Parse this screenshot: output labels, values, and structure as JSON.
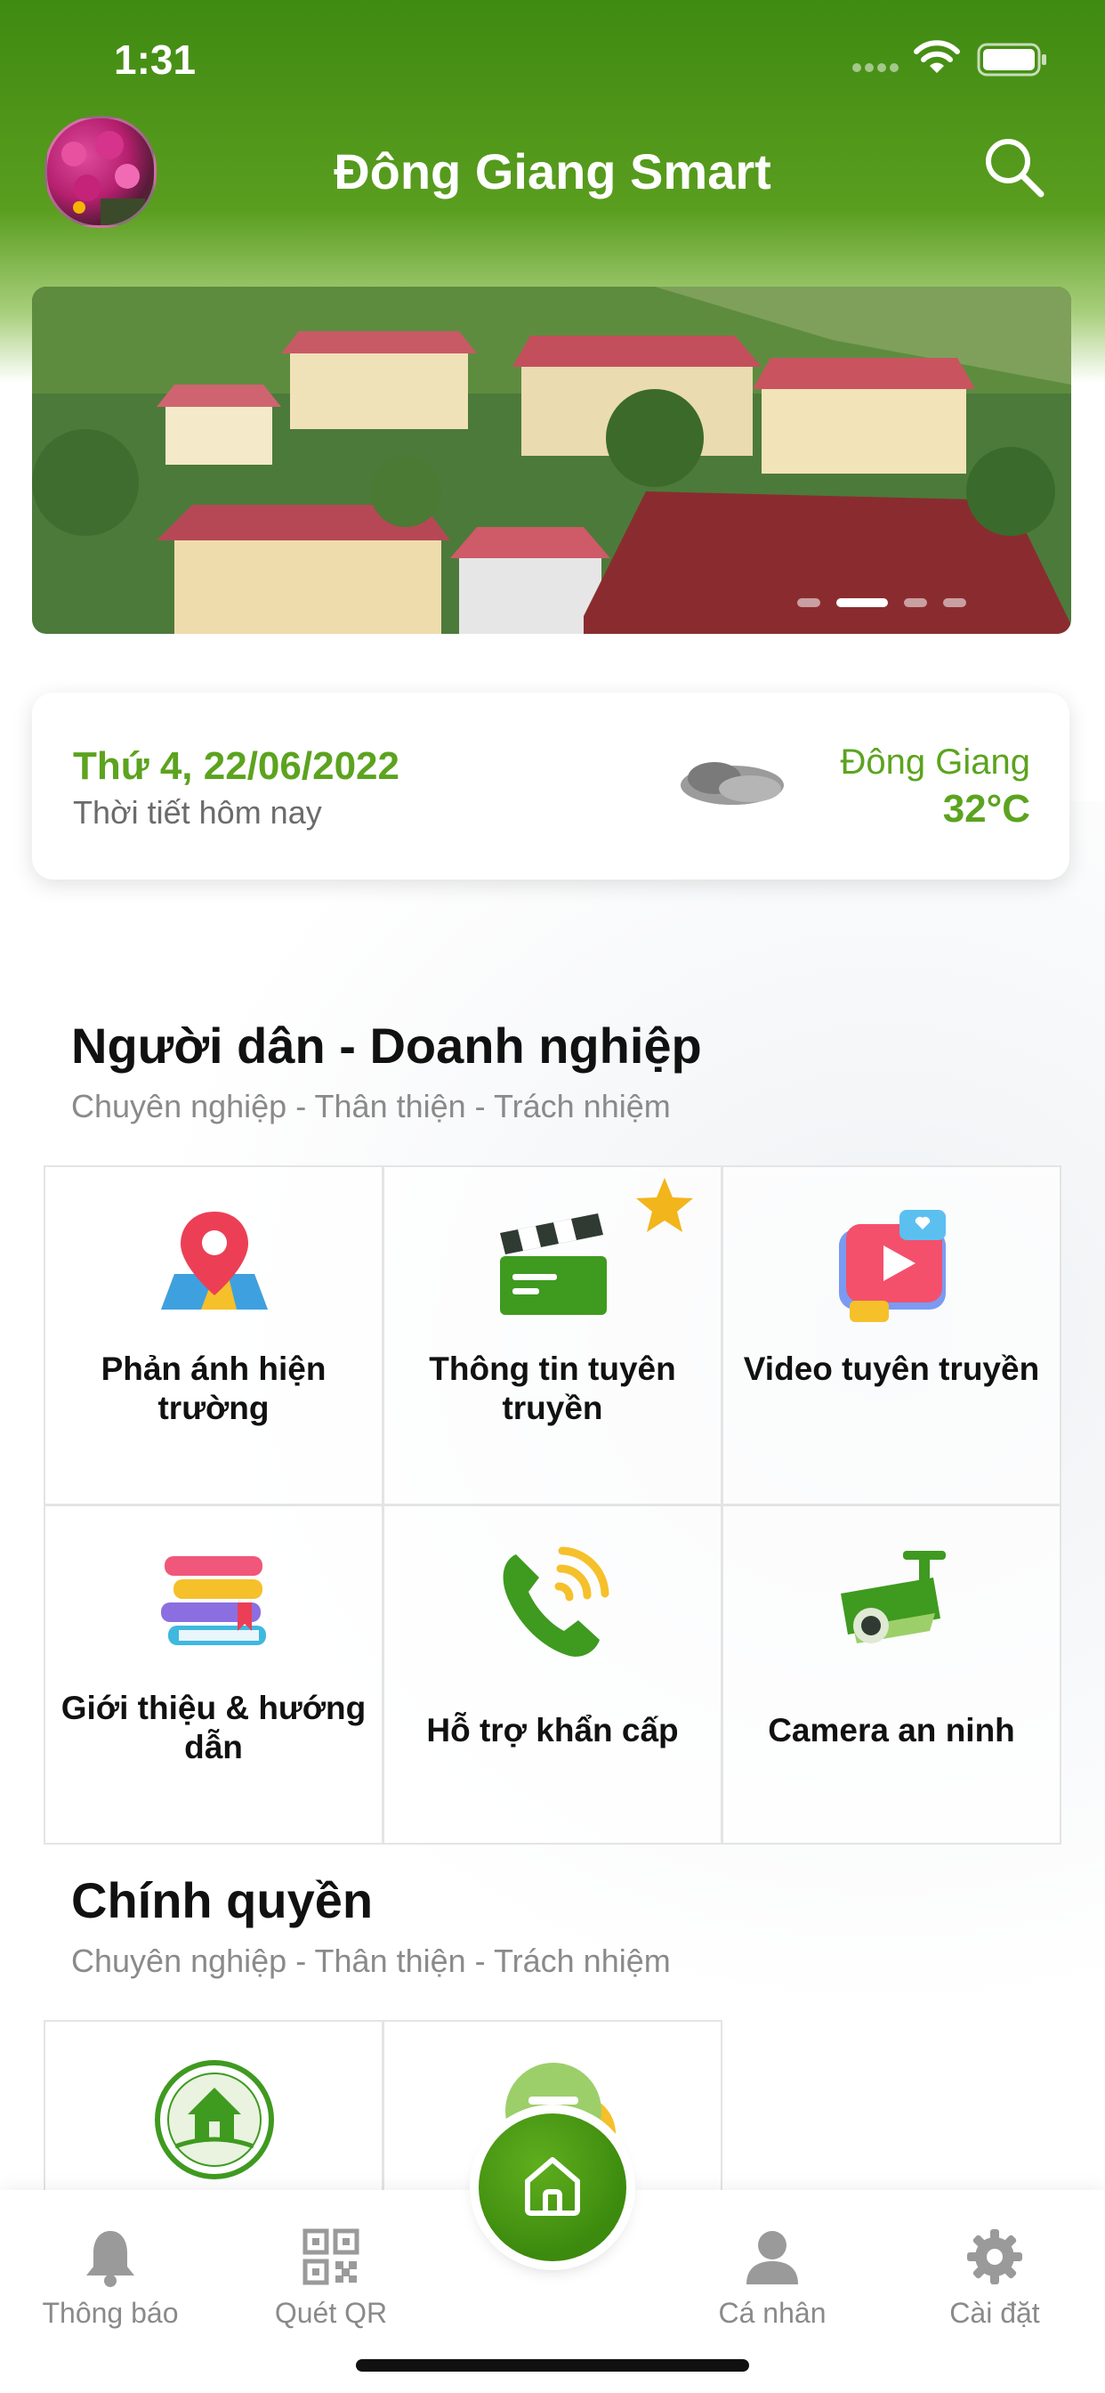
{
  "status_bar": {
    "time": "1:31"
  },
  "header": {
    "title": "Đông Giang Smart",
    "search_icon": "search-icon"
  },
  "banner": {
    "slide_count": 4,
    "active_slide": 2
  },
  "weather": {
    "date": "Thứ 4, 22/06/2022",
    "subtitle": "Thời tiết hôm nay",
    "location": "Đông Giang",
    "temperature": "32°C",
    "condition_icon": "cloud-icon"
  },
  "section_citizens": {
    "title": "Người dân - Doanh nghiệp",
    "subtitle": "Chuyên nghiệp - Thân thiện - Trách nhiệm",
    "tiles": [
      {
        "label": "Phản ánh hiện trường",
        "icon": "map-pin-icon"
      },
      {
        "label": "Thông tin tuyên truyền",
        "icon": "clapperboard-icon",
        "starred": true
      },
      {
        "label": "Video tuyên truyền",
        "icon": "video-play-icon"
      },
      {
        "label": "Giới thiệu & hướng dẫn",
        "icon": "books-icon"
      },
      {
        "label": "Hỗ trợ khẩn cấp",
        "icon": "phone-call-icon"
      },
      {
        "label": "Camera an ninh",
        "icon": "security-camera-icon"
      }
    ]
  },
  "section_gov": {
    "title": "Chính quyền",
    "subtitle": "Chuyên nghiệp - Thân thiện - Trách nhiệm",
    "tiles": [
      {
        "label": "",
        "icon": "government-seal-icon"
      },
      {
        "label": "",
        "icon": "menu-circle-icon"
      }
    ]
  },
  "bottom_nav": {
    "items": [
      {
        "label": "Thông báo",
        "icon": "bell-icon"
      },
      {
        "label": "Quét QR",
        "icon": "qr-code-icon"
      },
      {
        "label": "",
        "icon": "home-icon"
      },
      {
        "label": "Cá nhân",
        "icon": "person-icon"
      },
      {
        "label": "Cài đặt",
        "icon": "gear-icon"
      }
    ]
  },
  "colors": {
    "brand_green": "#4f9a17",
    "accent_green": "#5ca31f",
    "star": "#f2b51c"
  }
}
